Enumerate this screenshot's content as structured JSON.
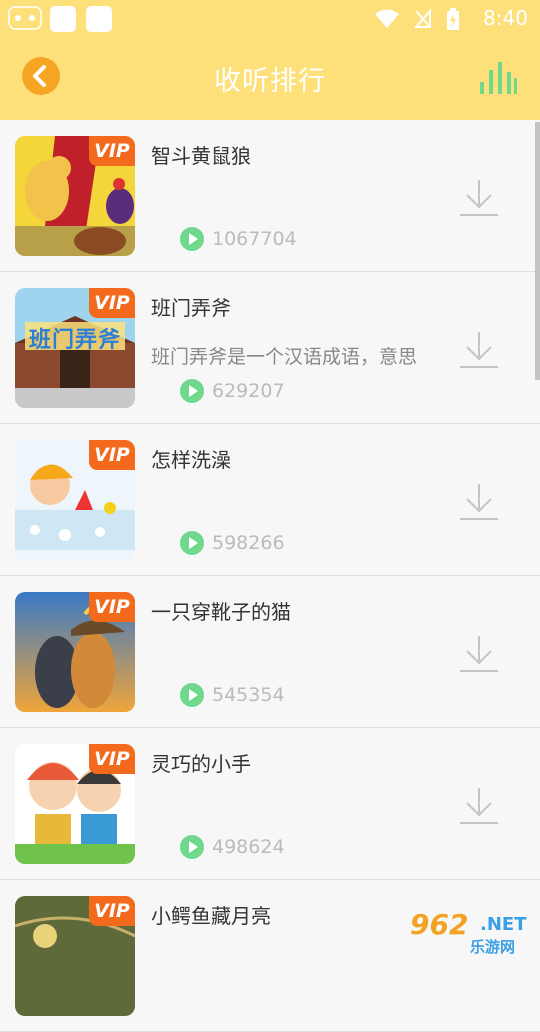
{
  "status_bar": {
    "time": "8:40"
  },
  "header": {
    "title": "收听排行"
  },
  "colors": {
    "header_bg": "#fde07a",
    "vip_badge": "#f36a1c",
    "play_icon": "#6fd88a",
    "accent_orange": "#f6a623"
  },
  "list": {
    "badge_label": "VIP",
    "items": [
      {
        "title": "智斗黄鼠狼",
        "desc": "",
        "plays": "1067704",
        "cover_icon": "weasel-and-rooster-cover"
      },
      {
        "title": "班门弄斧",
        "desc": "班门弄斧是一个汉语成语，意思",
        "plays": "629207",
        "cover_icon": "temple-gate-cover",
        "cover_text": "班门弄斧"
      },
      {
        "title": "怎样洗澡",
        "desc": "",
        "plays": "598266",
        "cover_icon": "child-bathing-cover"
      },
      {
        "title": "一只穿靴子的猫",
        "desc": "",
        "plays": "545354",
        "cover_icon": "puss-in-boots-cover"
      },
      {
        "title": "灵巧的小手",
        "desc": "",
        "plays": "498624",
        "cover_icon": "two-kids-cover"
      },
      {
        "title": "小鳄鱼藏月亮",
        "desc": "",
        "plays": "",
        "cover_icon": "little-crocodile-cover"
      }
    ]
  },
  "watermark": {
    "number": "962",
    "net": ".NET",
    "site": "乐游网"
  }
}
